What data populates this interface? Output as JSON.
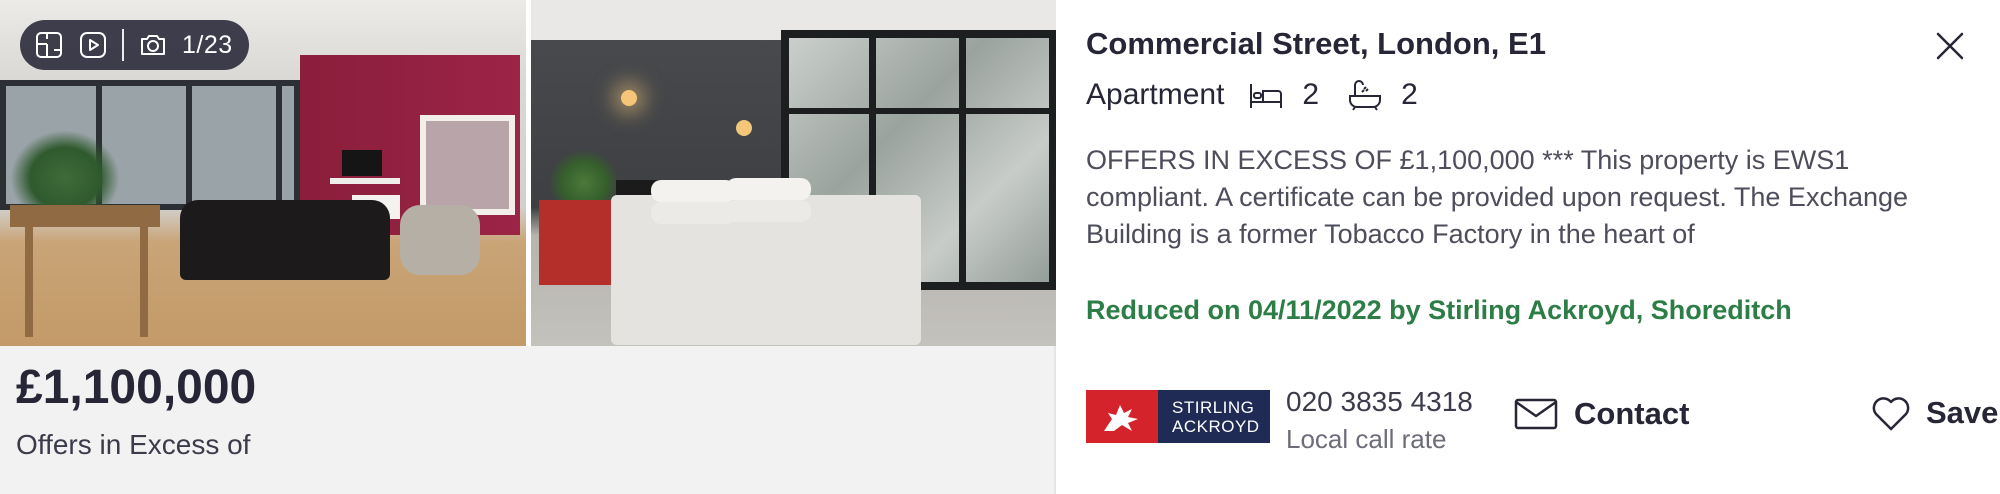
{
  "gallery": {
    "counter": "1/23",
    "icons": [
      "floorplan-icon",
      "video-icon",
      "camera-icon"
    ]
  },
  "listing": {
    "price": "£1,100,000",
    "price_qualifier": "Offers in Excess of",
    "address": "Commercial Street, London, E1",
    "property_type": "Apartment",
    "bedrooms": "2",
    "bathrooms": "2",
    "description": "OFFERS IN EXCESS OF £1,100,000 *** This property is EWS1 compliant. A certificate can be provided upon request. The Exchange Building is a former Tobacco Factory in the heart of",
    "reduced_text": "Reduced on 04/11/2022 by Stirling Ackroyd, Shoreditch"
  },
  "agent": {
    "logo_line1": "STIRLING",
    "logo_line2": "ACKROYD",
    "phone": "020 3835 4318",
    "phone_note": "Local call rate"
  },
  "actions": {
    "contact_label": "Contact",
    "save_label": "Save"
  },
  "colors": {
    "text": "#262637",
    "reduced_green": "#2d7d46",
    "logo_red": "#d5232b",
    "logo_navy": "#1f2a55"
  }
}
